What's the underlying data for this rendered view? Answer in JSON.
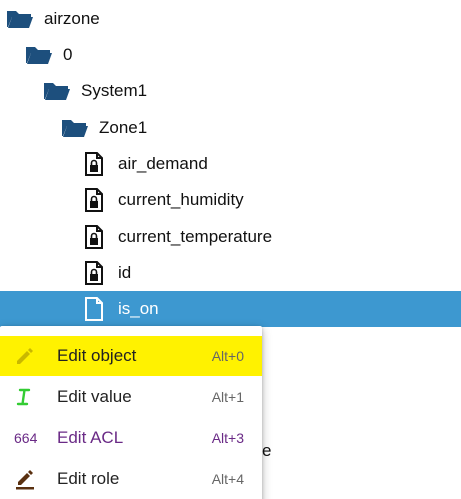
{
  "tree": {
    "rows": [
      {
        "label": "airzone",
        "icon": "folder-open-icon"
      },
      {
        "label": "0",
        "icon": "folder-open-icon"
      },
      {
        "label": "System1",
        "icon": "folder-open-icon"
      },
      {
        "label": "Zone1",
        "icon": "folder-open-icon"
      },
      {
        "label": "air_demand",
        "icon": "locked-file-icon"
      },
      {
        "label": "current_humidity",
        "icon": "locked-file-icon"
      },
      {
        "label": "current_temperature",
        "icon": "locked-file-icon"
      },
      {
        "label": "id",
        "icon": "locked-file-icon"
      },
      {
        "label": "is_on",
        "icon": "file-icon",
        "selected": true
      }
    ],
    "partial_text": "e"
  },
  "context_menu": {
    "items": [
      {
        "label": "Edit object",
        "shortcut": "Alt+0",
        "icon": "pencil-icon",
        "highlighted": true
      },
      {
        "label": "Edit value",
        "shortcut": "Alt+1",
        "icon": "text-cursor-icon"
      },
      {
        "label": "Edit ACL",
        "shortcut": "Alt+3",
        "icon_text": "664",
        "icon": "acl-icon"
      },
      {
        "label": "Edit role",
        "shortcut": "Alt+4",
        "icon": "edit-role-icon"
      }
    ]
  },
  "colors": {
    "folder": "#1d4f7d",
    "selection": "#3d98d0",
    "highlight": "#fff200",
    "acl_purple": "#6a2a86",
    "value_icon_green": "#33cc33"
  }
}
